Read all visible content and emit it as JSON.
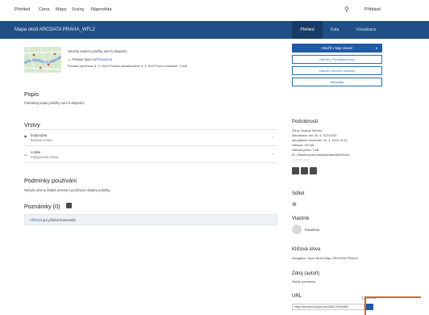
{
  "nav": {
    "items": [
      "Přehled",
      "Cena",
      "Mapy",
      "Scény",
      "Nápověda"
    ],
    "signin": "Přihlásit"
  },
  "header": {
    "title": "Mapa okolí ARCDATA PRAHA_WFL2",
    "tabs": [
      "Přehled",
      "Data",
      "Vizualizace"
    ]
  },
  "summary": {
    "text": "Stručný souhrn položky není k dispozici.",
    "layer_prefix": "Feature layer od",
    "owner": "hasudova",
    "dates": "Položka vytvořena: 8. 3. 2023   Položka aktualizována: 8. 3. 2023   Počet zobrazení: 3,444"
  },
  "description": {
    "heading": "Popis",
    "text": "Podrobný popis položky není k dispozici."
  },
  "layers": {
    "heading": "Vrstvy",
    "items": [
      {
        "name": "budynajina",
        "sub": "Bodová vrstva"
      },
      {
        "name": "mobile",
        "sub": "Polygonová vrstva"
      }
    ]
  },
  "terms": {
    "heading": "Podmínky používání",
    "text": "Nebyla určena žádná omezení používání obsahu položky."
  },
  "comments": {
    "heading": "Poznámky (0)",
    "signin_link": "Přihlásit",
    "signin_text": " pro přidání komentáře."
  },
  "actions": {
    "primary": "Otevřít v Map Viewer",
    "secondary": [
      "Otevřít v Prohlížeči scén",
      "Otevřít v ArcGIS Desktop",
      "Metadata"
    ]
  },
  "details": {
    "heading": "Podrobnosti",
    "lines": [
      "Zdroj: Feature Service",
      "Aktualizace dat: 24. 4. 2024 8:53",
      "Aktualizace schématu: 24. 4. 2024 10:22",
      "Velikost: 120 kB",
      "Velikost příloh: 0 kB",
      "ID: 045a6bc4be0c4ba2b6e8fae3682994c1"
    ],
    "stars": "☆☆☆☆☆"
  },
  "share": {
    "heading": "Sdílet"
  },
  "owner_section": {
    "heading": "Vlastník",
    "name": "hasudova"
  },
  "tags": {
    "heading": "Klíčová slova",
    "text": "navigation, Open Street Map, ARCDATA PRAHA"
  },
  "credits": {
    "heading": "Zdroj (autoři)",
    "text": "Žádné poznámky."
  },
  "url": {
    "heading": "URL",
    "view": "Zobrazit",
    "value": "https://services.arcgis.com/NeDCSVNMNH"
  },
  "colors": {
    "header": "#1f4f86",
    "accent": "#2e6bb8",
    "highlight": "#e0611c"
  }
}
